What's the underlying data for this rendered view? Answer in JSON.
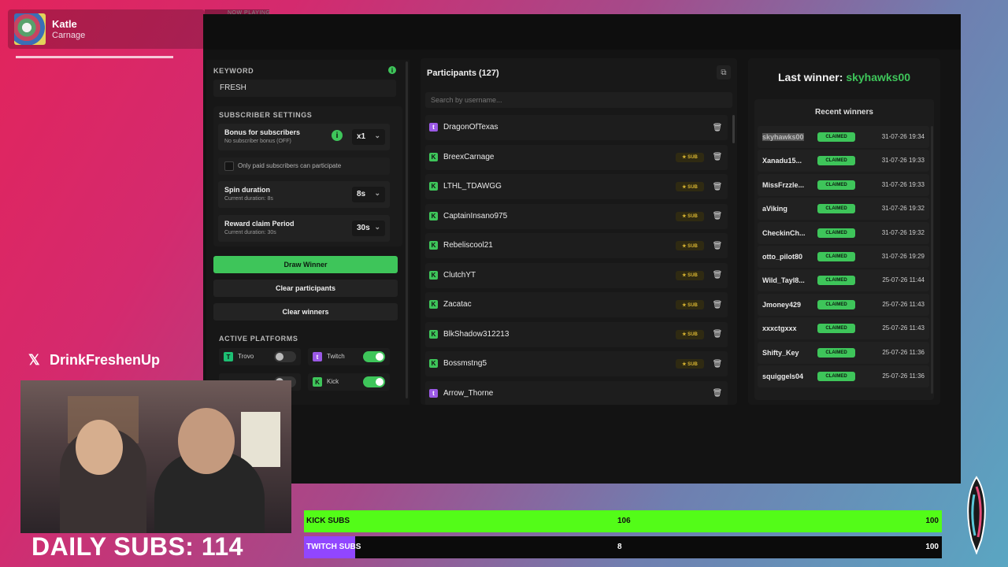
{
  "now_playing": {
    "label": "NOW PLAYING",
    "title": "Katle",
    "artist": "Carnage"
  },
  "settings": {
    "keyword_label": "KEYWORD",
    "keyword_value": "FRESH",
    "subscriber_settings_label": "SUBSCRIBER SETTINGS",
    "bonus_label": "Bonus for subscribers",
    "bonus_sub": "No subscriber bonus (OFF)",
    "bonus_value": "x1",
    "paid_only_label": "Only paid subscribers can participate",
    "spin_label": "Spin duration",
    "spin_sub": "Current duration: 8s",
    "spin_value": "8s",
    "reward_label": "Reward claim Period",
    "reward_sub": "Current duration: 30s",
    "reward_value": "30s",
    "draw_button": "Draw Winner",
    "clear_participants_button": "Clear participants",
    "clear_winners_button": "Clear winners",
    "platforms_label": "ACTIVE PLATFORMS",
    "platforms": [
      {
        "name": "Trovo",
        "enabled": false,
        "color": "#1dbf73"
      },
      {
        "name": "Twitch",
        "enabled": true,
        "color": "#9b59e6"
      },
      {
        "name": "Kick",
        "enabled": true,
        "color": "#3ec55a"
      }
    ]
  },
  "participants": {
    "title": "Participants (127)",
    "search_placeholder": "Search by username...",
    "sub_badge": "★ SUB",
    "rows": [
      {
        "name": "DragonOfTexas",
        "platform": "twitch",
        "sub": false
      },
      {
        "name": "BreexCarnage",
        "platform": "kick",
        "sub": true
      },
      {
        "name": "LTHL_TDAWGG",
        "platform": "kick",
        "sub": true
      },
      {
        "name": "CaptainInsano975",
        "platform": "kick",
        "sub": true
      },
      {
        "name": "Rebeliscool21",
        "platform": "kick",
        "sub": true
      },
      {
        "name": "ClutchYT",
        "platform": "kick",
        "sub": true
      },
      {
        "name": "Zacatac",
        "platform": "kick",
        "sub": true
      },
      {
        "name": "BlkShadow312213",
        "platform": "kick",
        "sub": true
      },
      {
        "name": "Bossmstng5",
        "platform": "kick",
        "sub": true
      },
      {
        "name": "Arrow_Thorne",
        "platform": "twitch",
        "sub": false
      }
    ]
  },
  "winners": {
    "last_winner_label": "Last winner:",
    "last_winner_name": "skyhawks00",
    "recent_title": "Recent winners",
    "claimed_label": "CLAIMED",
    "rows": [
      {
        "name": "skyhawks00",
        "date": "31-07-26 19:34"
      },
      {
        "name": "Xanadu15...",
        "date": "31-07-26 19:33"
      },
      {
        "name": "MissFrzzle...",
        "date": "31-07-26 19:33"
      },
      {
        "name": "aViking",
        "date": "31-07-26 19:32"
      },
      {
        "name": "CheckinCh...",
        "date": "31-07-26 19:32"
      },
      {
        "name": "otto_pilot80",
        "date": "31-07-26 19:29"
      },
      {
        "name": "Wild_Tayl8...",
        "date": "25-07-26 11:44"
      },
      {
        "name": "Jmoney429",
        "date": "25-07-26 11:43"
      },
      {
        "name": "xxxctgxxx",
        "date": "25-07-26 11:43"
      },
      {
        "name": "Shifty_Key",
        "date": "25-07-26 11:36"
      },
      {
        "name": "squiggels04",
        "date": "25-07-26 11:36"
      }
    ]
  },
  "overlay": {
    "x_handle": "DrinkFreshenUp",
    "daily_subs": "DAILY SUBS: 114",
    "kick_subs": {
      "label": "KICK SUBS",
      "count": "106",
      "goal": "100",
      "progress": 1.0,
      "color": "#53fc18"
    },
    "twitch_subs": {
      "label": "TWITCH SUBS",
      "count": "8",
      "goal": "100",
      "progress": 0.08,
      "color": "#9146ff"
    }
  }
}
